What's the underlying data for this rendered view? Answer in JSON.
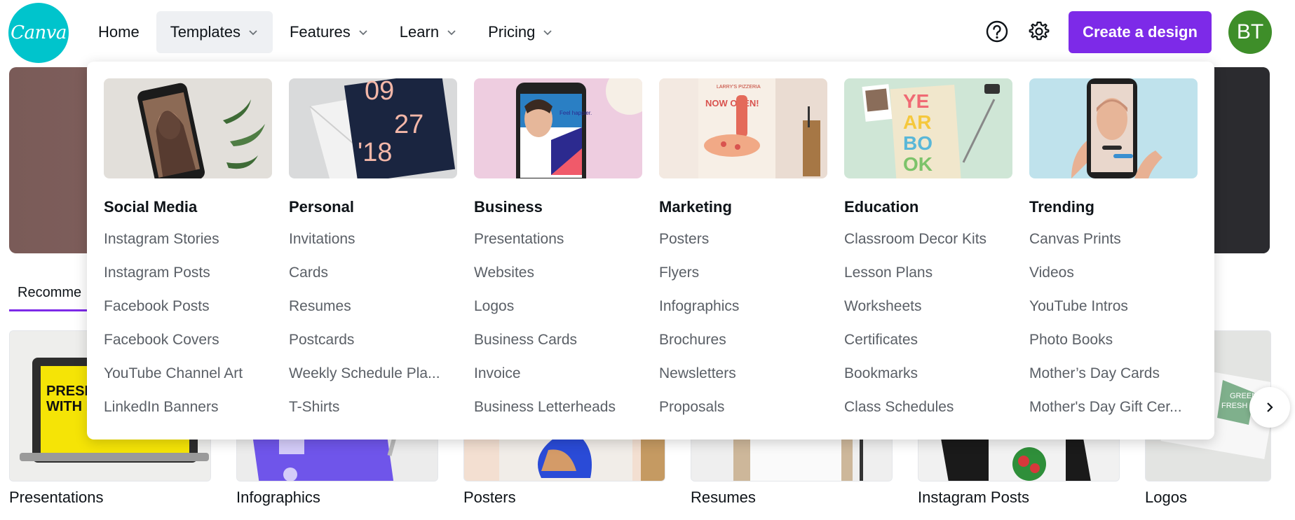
{
  "brand": {
    "logo_text": "Canva",
    "accent": "#7d2ae8",
    "logo_color": "#00c4cc"
  },
  "nav": {
    "items": [
      {
        "label": "Home",
        "has_dropdown": false
      },
      {
        "label": "Templates",
        "has_dropdown": true,
        "active": true
      },
      {
        "label": "Features",
        "has_dropdown": true
      },
      {
        "label": "Learn",
        "has_dropdown": true
      },
      {
        "label": "Pricing",
        "has_dropdown": true
      }
    ],
    "help_icon": "help-circle-icon",
    "settings_icon": "gear-icon",
    "create_label": "Create a design",
    "avatar_initials": "BT"
  },
  "menu": {
    "columns": [
      {
        "title": "Social Media",
        "links": [
          "Instagram Stories",
          "Instagram Posts",
          "Facebook Posts",
          "Facebook Covers",
          "YouTube Channel Art",
          "LinkedIn Banners"
        ]
      },
      {
        "title": "Personal",
        "links": [
          "Invitations",
          "Cards",
          "Resumes",
          "Postcards",
          "Weekly Schedule Pla...",
          "T-Shirts"
        ]
      },
      {
        "title": "Business",
        "links": [
          "Presentations",
          "Websites",
          "Logos",
          "Business Cards",
          "Invoice",
          "Business Letterheads"
        ]
      },
      {
        "title": "Marketing",
        "links": [
          "Posters",
          "Flyers",
          "Infographics",
          "Brochures",
          "Newsletters",
          "Proposals"
        ]
      },
      {
        "title": "Education",
        "links": [
          "Classroom Decor Kits",
          "Lesson Plans",
          "Worksheets",
          "Certificates",
          "Bookmarks",
          "Class Schedules"
        ]
      },
      {
        "title": "Trending",
        "links": [
          "Canvas Prints",
          "Videos",
          "YouTube Intros",
          "Photo Books",
          "Mother’s Day Cards",
          "Mother's Day Gift Cer..."
        ]
      }
    ],
    "image_text": {
      "personal_card": [
        "09",
        "27",
        "'18"
      ],
      "business_phone": "Feel happier.",
      "marketing_poster_brand": "LARRY'S PIZZERIA",
      "marketing_poster_headline": "NOW OPEN!",
      "education_book": [
        "YE",
        "AR",
        "BO",
        "OK"
      ]
    }
  },
  "page": {
    "tab_label": "Recomme",
    "thumbnails": [
      "Presentations",
      "Infographics",
      "Posters",
      "Resumes",
      "Instagram Posts",
      "Logos"
    ],
    "presentation_thumb_text": [
      "PRESE",
      "WITH E"
    ],
    "logo_thumb_text": [
      "GREEN",
      "FRESH C"
    ]
  }
}
